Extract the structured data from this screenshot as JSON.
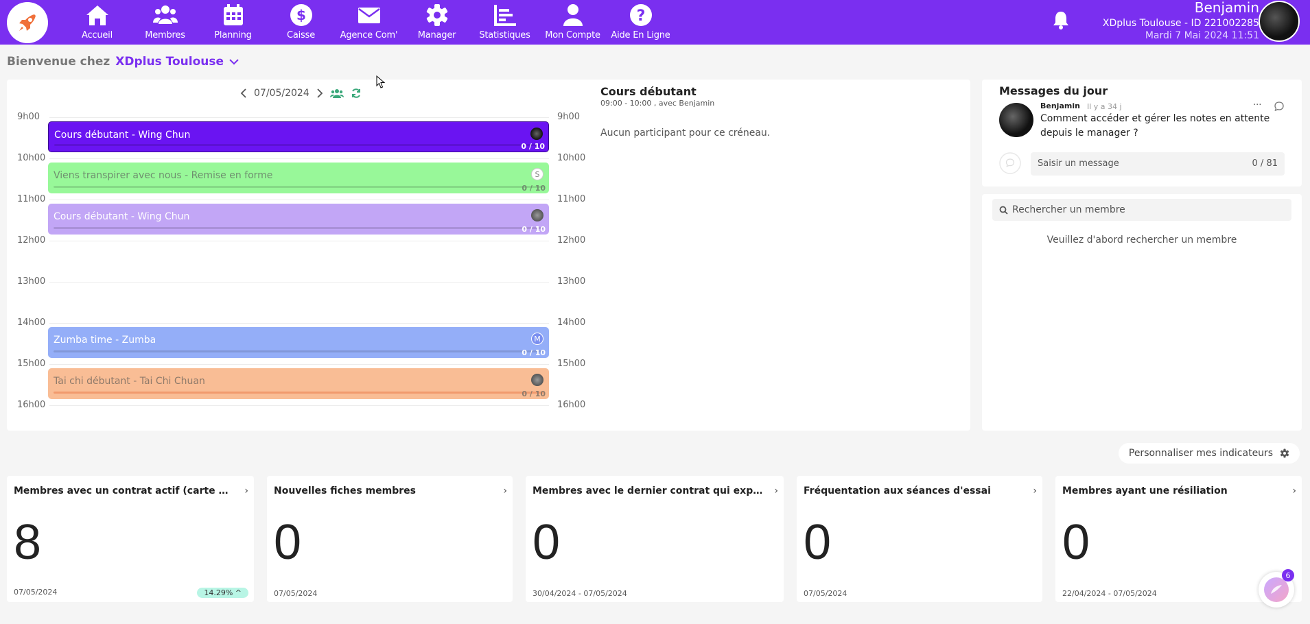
{
  "nav": {
    "items": [
      {
        "label": "Accueil",
        "icon": "home-icon"
      },
      {
        "label": "Membres",
        "icon": "users-icon"
      },
      {
        "label": "Planning",
        "icon": "calendar-icon"
      },
      {
        "label": "Caisse",
        "icon": "dollar-icon"
      },
      {
        "label": "Agence Com'",
        "icon": "envelope-icon"
      },
      {
        "label": "Manager",
        "icon": "gear-icon"
      },
      {
        "label": "Statistiques",
        "icon": "chart-icon"
      },
      {
        "label": "Mon Compte",
        "icon": "user-icon"
      },
      {
        "label": "Aide En Ligne",
        "icon": "help-icon"
      }
    ]
  },
  "user": {
    "name": "Benjamin",
    "club": "XDplus Toulouse - ID 221002285",
    "datetime": "Mardi 7 Mai 2024 11:51"
  },
  "welcome": {
    "prefix": "Bienvenue chez",
    "club": "XDplus Toulouse"
  },
  "calendar": {
    "date": "07/05/2024",
    "hours": [
      "9h00",
      "10h00",
      "11h00",
      "12h00",
      "13h00",
      "14h00",
      "15h00",
      "16h00"
    ],
    "events": [
      {
        "title": "Cours débutant - Wing Chun",
        "count": "0 / 10",
        "color": "#6a14f2",
        "text_color": "#ffffff",
        "avatar": ""
      },
      {
        "title": "Viens transpirer avec nous - Remise en forme",
        "count": "0 / 10",
        "color": "#98f899",
        "text_color": "#6f8f6f",
        "avatar": "S"
      },
      {
        "title": "Cours débutant - Wing Chun",
        "count": "0 / 10",
        "color": "#c2a6f6",
        "text_color": "#ffffff",
        "avatar": ""
      },
      {
        "title": "Zumba time - Zumba",
        "count": "0 / 10",
        "color": "#94aef8",
        "text_color": "#ffffff",
        "avatar": "M"
      },
      {
        "title": "Tai chi débutant - Tai Chi Chuan",
        "count": "0 / 10",
        "color": "#f9bd95",
        "text_color": "#8f7a6a",
        "avatar": ""
      }
    ]
  },
  "detail": {
    "title": "Cours débutant",
    "subtitle": "09:00 - 10:00 , avec Benjamin",
    "empty": "Aucun participant pour ce créneau."
  },
  "messages": {
    "title": "Messages du jour",
    "author": "Benjamin",
    "time": "Il y a 34 j",
    "text": "Comment accéder et gérer les notes en attente depuis le manager ?",
    "more": "···",
    "input_placeholder": "Saisir un message",
    "input_count": "0 / 81"
  },
  "member_search": {
    "placeholder": "Rechercher un membre",
    "empty": "Veuillez d'abord rechercher un membre"
  },
  "indicators": {
    "customize_label": "Personnaliser mes indicateurs",
    "chevron": "›",
    "cards": [
      {
        "title": "Membres avec un contrat actif (carte ou abo)",
        "value": "8",
        "date": "07/05/2024",
        "badge": "14.29% ^"
      },
      {
        "title": "Nouvelles fiches membres",
        "value": "0",
        "date": "07/05/2024",
        "badge": ""
      },
      {
        "title": "Membres avec le dernier contrat qui expire / s...",
        "value": "0",
        "date": "30/04/2024 - 07/05/2024",
        "badge": ""
      },
      {
        "title": "Fréquentation aux séances d'essai",
        "value": "0",
        "date": "07/05/2024",
        "badge": ""
      },
      {
        "title": "Membres ayant une résiliation",
        "value": "0",
        "date": "22/04/2024 - 07/05/2024",
        "badge": ""
      }
    ]
  },
  "chat_fab": {
    "badge": "6"
  }
}
